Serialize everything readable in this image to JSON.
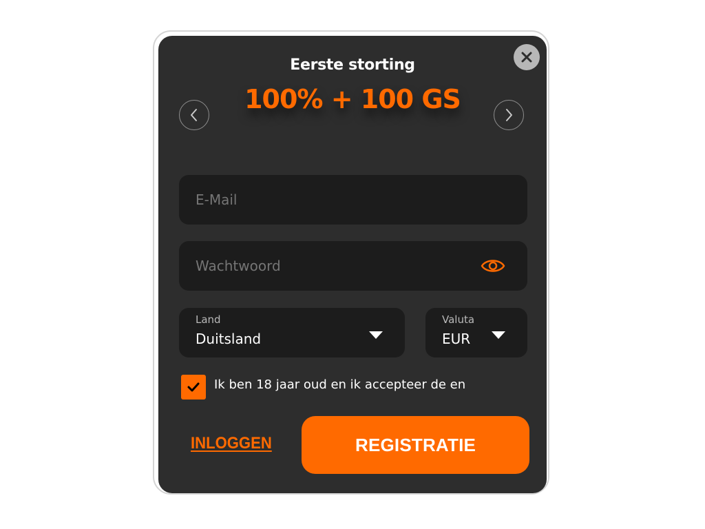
{
  "modal": {
    "title": "Eerste storting",
    "bonus": "100% + 100 GS"
  },
  "icons": {
    "close": "close-icon",
    "prev": "chevron-left-icon",
    "next": "chevron-right-icon",
    "password_toggle": "eye-icon",
    "dropdown": "caret-down-icon",
    "checkbox": "checkmark-icon"
  },
  "form": {
    "email": {
      "placeholder": "E-Mail",
      "value": ""
    },
    "password": {
      "placeholder": "Wachtwoord",
      "value": ""
    },
    "country": {
      "label": "Land",
      "value": "Duitsland"
    },
    "currency": {
      "label": "Valuta",
      "value": "EUR"
    },
    "terms": {
      "checked": true,
      "text": "Ik ben 18 jaar oud en ik accepteer de en"
    }
  },
  "actions": {
    "login_label": "INLOGGEN",
    "register_label": "REGISTRATIE"
  },
  "colors": {
    "accent": "#ff6a00",
    "modal_background": "#2d2d2d",
    "field_background": "#1c1c1c",
    "close_button": "#b7b7b7"
  }
}
